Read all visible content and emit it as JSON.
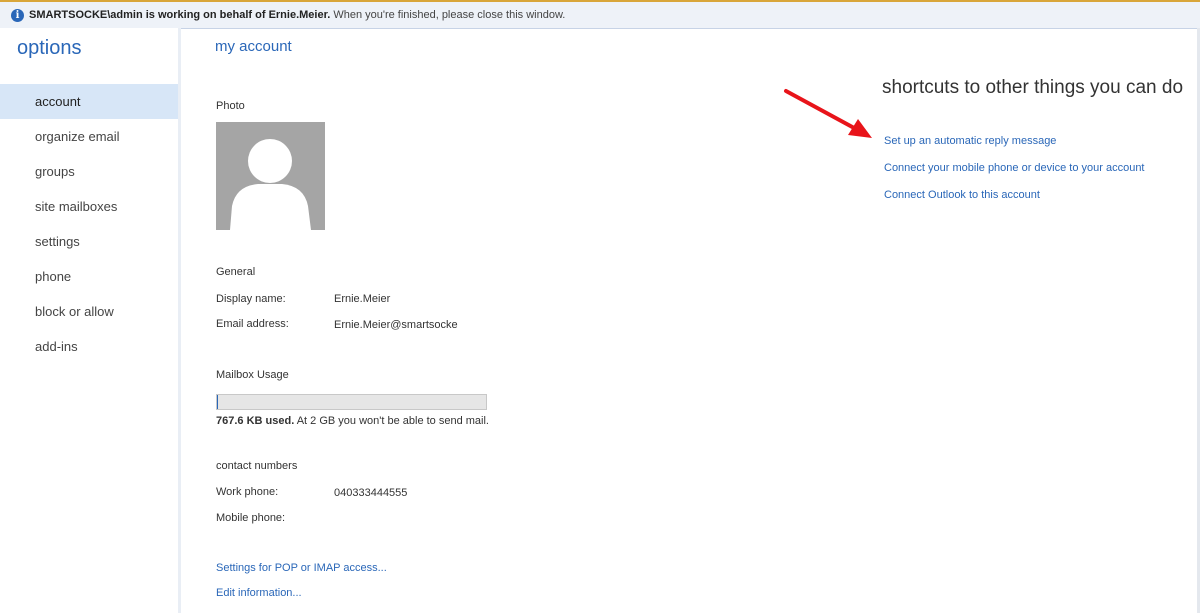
{
  "infobar": {
    "icon": "info-icon",
    "bold_text": "SMARTSOCKE\\admin is working on behalf of Ernie.Meier.",
    "rest_text": "When you're finished, please close this window."
  },
  "sidebar": {
    "title": "options",
    "items": [
      {
        "label": "account",
        "active": true
      },
      {
        "label": "organize email",
        "active": false
      },
      {
        "label": "groups",
        "active": false
      },
      {
        "label": "site mailboxes",
        "active": false
      },
      {
        "label": "settings",
        "active": false
      },
      {
        "label": "phone",
        "active": false
      },
      {
        "label": "block or allow",
        "active": false
      },
      {
        "label": "add-ins",
        "active": false
      }
    ]
  },
  "main": {
    "title": "my account",
    "photo_label": "Photo",
    "general": {
      "heading": "General",
      "display_name_label": "Display name:",
      "display_name_value": "Ernie.Meier",
      "email_label": "Email address:",
      "email_value": "Ernie.Meier@smartsocke"
    },
    "mailbox": {
      "heading": "Mailbox Usage",
      "usage_fraction": 0.0004,
      "used_bold": "767.6 KB used.",
      "used_rest": "At 2 GB you won't be able to send mail."
    },
    "contact": {
      "heading": "contact numbers",
      "work_label": "Work phone:",
      "work_value": "040333444555",
      "mobile_label": "Mobile phone:",
      "mobile_value": ""
    },
    "links": {
      "pop_imap": "Settings for POP or IMAP access...",
      "edit_info": "Edit information..."
    }
  },
  "shortcuts": {
    "title": "shortcuts to other things you can do",
    "links": [
      "Set up an automatic reply message",
      "Connect your mobile phone or device to your account",
      "Connect Outlook to this account"
    ]
  },
  "colors": {
    "accent": "#2a67b8",
    "active_nav": "#d7e6f7",
    "annotation_arrow": "#e8141a"
  }
}
